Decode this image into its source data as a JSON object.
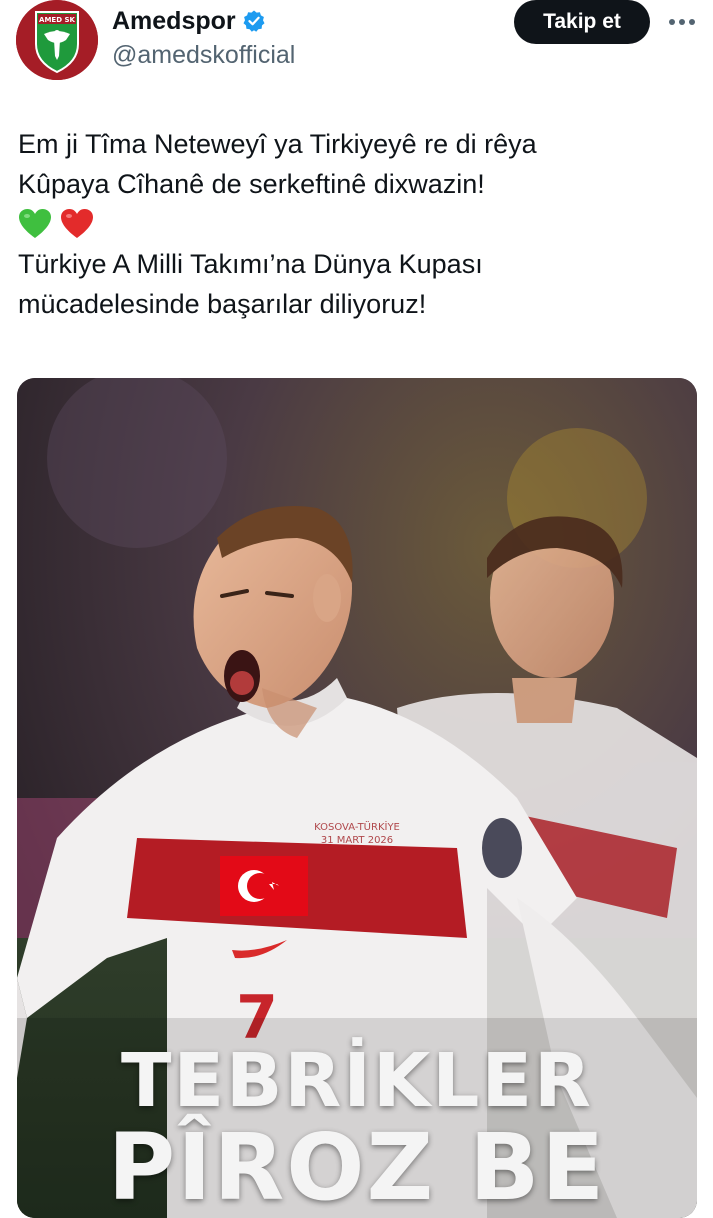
{
  "user": {
    "display_name": "Amedspor",
    "handle": "@amedskofficial",
    "verified": true,
    "avatar_icon": "amedspor-crest-icon",
    "avatar_text": "AMED SK"
  },
  "actions": {
    "follow_label": "Takip et",
    "more_icon": "more-dots-icon"
  },
  "tweet": {
    "line1": "Em ji Tîma Neteweyî ya Tirkiyeyê re di rêya",
    "line2": "Kûpaya Cîhanê de serkeftinê dixwazin!",
    "emojis": [
      "green-heart-icon",
      "red-heart-icon"
    ],
    "line3": "Türkiye A Milli Takımı’na Dünya Kupası",
    "line4": "mücadelesinde başarılar diliyoruz!"
  },
  "media": {
    "jersey_text": "KOSOVA-TÜRKİYE",
    "jersey_date": "31 MART 2026",
    "shirt_number": "7",
    "overlay_line1": "TEBRİKLER",
    "overlay_line2": "PÎROZ BE"
  },
  "colors": {
    "follow_bg": "#0f1419",
    "verified_blue": "#1d9bf0",
    "text_secondary": "#536471",
    "crest_red": "#a51d26",
    "crest_green": "#1f9a3c",
    "flag_red": "#e30a17"
  }
}
